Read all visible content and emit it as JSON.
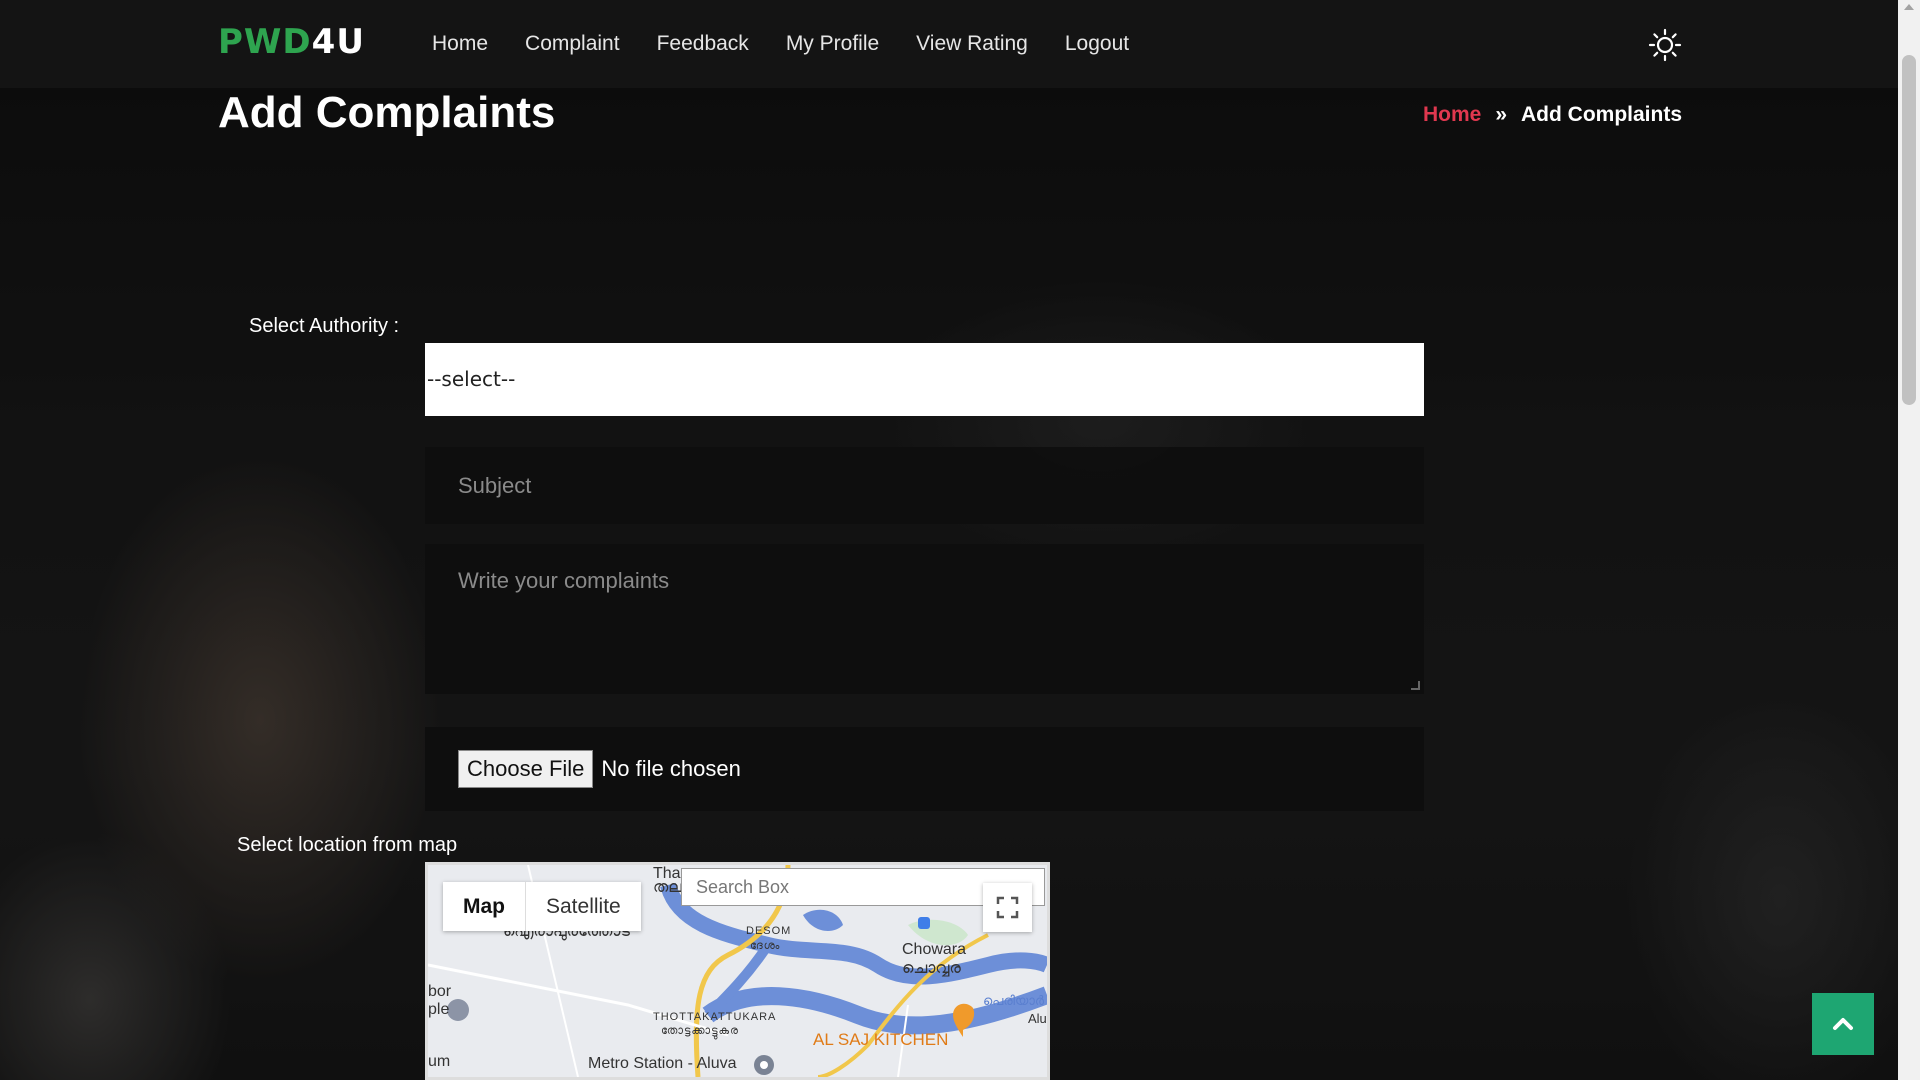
{
  "brand": {
    "part1": "PWD",
    "part2": "4U"
  },
  "nav": {
    "items": [
      "Home",
      "Complaint",
      "Feedback",
      "My Profile",
      "View Rating",
      "Logout"
    ]
  },
  "page": {
    "title": "Add Complaints",
    "breadcrumb": {
      "home": "Home",
      "separator": "»",
      "current": "Add Complaints"
    }
  },
  "form": {
    "authority_label": "Select Authority :",
    "authority_selected": "--select--",
    "subject_placeholder": "Subject",
    "complaint_placeholder": "Write your complaints",
    "file_button": "Choose File",
    "file_status": "No file chosen",
    "map_label": "Select location from map"
  },
  "map": {
    "type_map": "Map",
    "type_satellite": "Satellite",
    "search_placeholder": "Search Box",
    "labels": {
      "desom": "DESOM",
      "desom_ml": "ദേശം",
      "chowara": "Chowara",
      "chowara_ml": "ചൊവ്വര",
      "thottakattukara": "THOTTAKATTUKARA",
      "thottakattukara_ml": "തോട്ടക്കാട്ടുകര",
      "restaurant": "AL SAJ KITCHEN",
      "metro": "Metro Station - Aluva",
      "tha": "Tha",
      "thal_ml": "തല",
      "top_ml": "ഐരാപുരത്തോട്",
      "periyar_ml": "പെരിയാർ",
      "alu": "Alu",
      "bor": "bor",
      "ple": "ple",
      "um": "um"
    }
  },
  "colors": {
    "brand_green": "#2ea44f",
    "breadcrumb_home": "#e0384f",
    "back_to_top": "#1ea672"
  },
  "icons": {
    "theme": "sun-icon",
    "back_to_top": "chevron-up-icon",
    "fullscreen": "fullscreen-icon"
  }
}
